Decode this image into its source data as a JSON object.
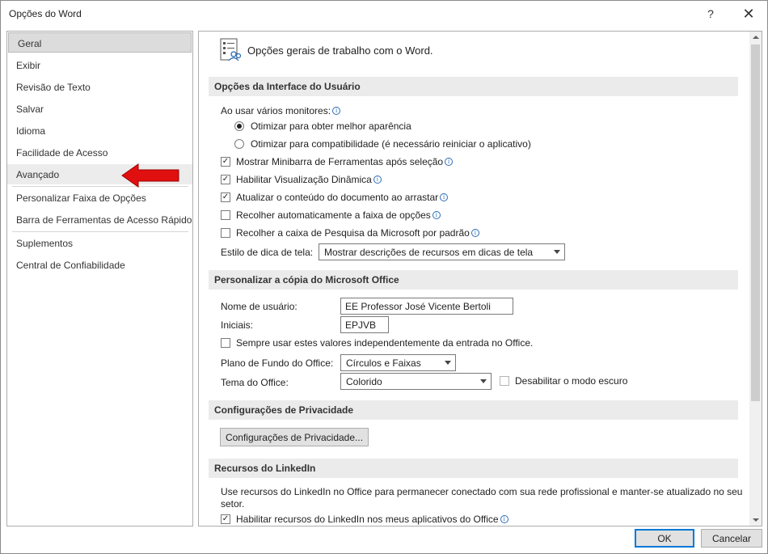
{
  "window": {
    "title": "Opções do Word",
    "help_glyph": "?",
    "close_glyph": "✕"
  },
  "sidebar": {
    "items": [
      {
        "label": "Geral"
      },
      {
        "label": "Exibir"
      },
      {
        "label": "Revisão de Texto"
      },
      {
        "label": "Salvar"
      },
      {
        "label": "Idioma"
      },
      {
        "label": "Facilidade de Acesso"
      },
      {
        "label": "Avançado"
      },
      {
        "label": "Personalizar Faixa de Opções"
      },
      {
        "label": "Barra de Ferramentas de Acesso Rápido"
      },
      {
        "label": "Suplementos"
      },
      {
        "label": "Central de Confiabilidade"
      }
    ],
    "selected": "Geral"
  },
  "header": {
    "text": "Opções gerais de trabalho com o Word.",
    "icon": "general-options-icon"
  },
  "sections": {
    "ui": {
      "title": "Opções da Interface do Usuário",
      "monitors_label": "Ao usar vários monitores:",
      "radio_best": "Otimizar para obter melhor aparência",
      "radio_compat": "Otimizar para compatibilidade (é necessário reiniciar o aplicativo)",
      "chk_minibar": "Mostrar Minibarra de Ferramentas após seleção",
      "chk_preview": "Habilitar Visualização Dinâmica",
      "chk_update": "Atualizar o conteúdo do documento ao arrastar",
      "chk_collapse": "Recolher automaticamente a faixa de opções",
      "chk_search": "Recolher a caixa de Pesquisa da Microsoft por padrão",
      "tooltip_label": "Estilo de dica de tela:",
      "tooltip_value": "Mostrar descrições de recursos em dicas de tela"
    },
    "personalize": {
      "title": "Personalizar a cópia do Microsoft Office",
      "username_label": "Nome de usuário:",
      "username_value": "EE Professor José Vicente Bertoli",
      "initials_label": "Iniciais:",
      "initials_value": "EPJVB",
      "always_use": "Sempre usar estes valores independentemente da entrada no Office.",
      "background_label": "Plano de Fundo do Office:",
      "background_value": "Círculos e Faixas",
      "theme_label": "Tema do Office:",
      "theme_value": "Colorido",
      "dark_mode": "Desabilitar o modo escuro"
    },
    "privacy": {
      "title": "Configurações de Privacidade",
      "button": "Configurações de Privacidade..."
    },
    "linkedin": {
      "title": "Recursos do LinkedIn",
      "description": "Use recursos do LinkedIn no Office para permanecer conectado com sua rede profissional e manter-se atualizado no seu setor.",
      "chk_enable": "Habilitar recursos do LinkedIn nos meus aplicativos do Office"
    }
  },
  "checks": {
    "minibar": true,
    "preview": true,
    "update": true,
    "collapse": false,
    "search": false,
    "always_use": false,
    "dark_mode": false,
    "linkedin": true
  },
  "buttons": {
    "ok": "OK",
    "cancel": "Cancelar"
  },
  "colors": {
    "annotation_arrow": "#e01010",
    "primary_border": "#0078d7",
    "info_icon": "#2b6cb5"
  }
}
